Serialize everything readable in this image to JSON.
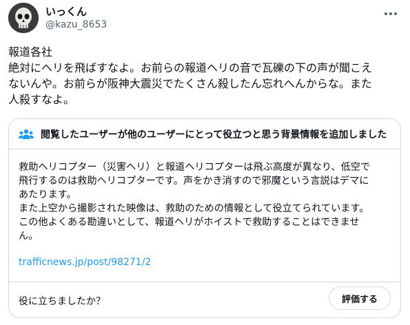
{
  "author": {
    "display_name": "いっくん",
    "handle": "@kazu_8653",
    "avatar_icon": "skull-avatar"
  },
  "more_icon": "more-dots-icon",
  "tweet": {
    "lines": [
      "報道各社",
      "絶対にヘリを飛ばすなよ。お前らの報道ヘリの音で瓦礫の下の声が聞こえ",
      "ないんや。お前らが阪神大震災でたくさん殺したん忘れへんからな。また",
      "人殺すなよ。"
    ]
  },
  "community_note": {
    "header_icon": "people-icon",
    "header": "閲覧したユーザーが他のユーザーにとって役立つと思う背景情報を追加しました",
    "body_lines": [
      "救助ヘリコプター（災害ヘリ）と報道ヘリコプターは飛ぶ高度が異なり、低空で",
      "飛行するのは救助ヘリコプターです。声をかき消すので邪魔という言説はデマに",
      "あたります。",
      "また上空から撮影された映像は、救助のための情報として役立てられています。",
      "この他よくある勘違いとして、報道ヘリがホイストで救助することはできませ",
      "ん。"
    ],
    "link": "trafficnews.jp/post/98271/2",
    "helpful_question": "役に立ちましたか？",
    "rate_button": "評価する"
  },
  "colors": {
    "text": "#0f1419",
    "secondary": "#536471",
    "link": "#1d9bf0",
    "border": "#cfd9de",
    "people_icon": "#1d9bf0"
  }
}
